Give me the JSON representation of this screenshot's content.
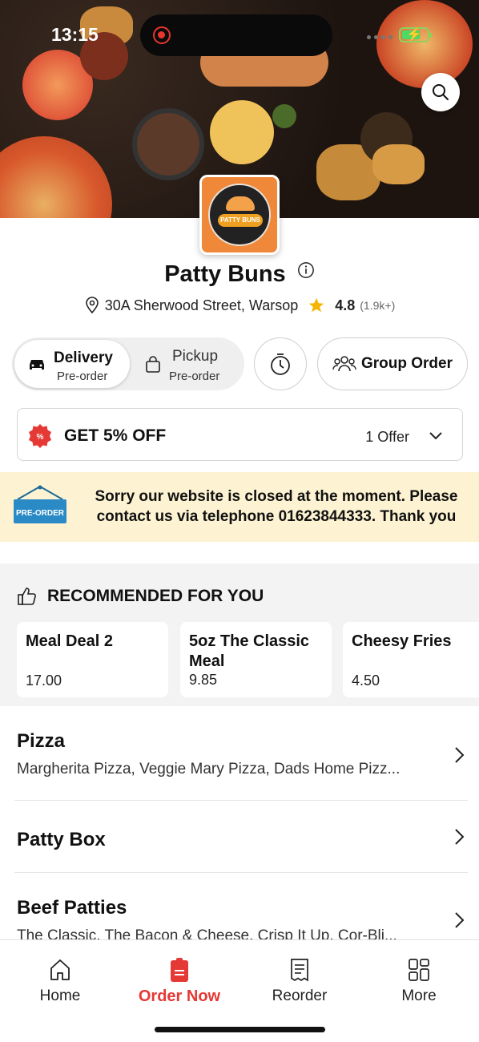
{
  "status": {
    "time": "13:15"
  },
  "restaurant": {
    "name": "Patty Buns",
    "logo_text": "PATTY BUNS",
    "address": "30A Sherwood Street, Warsop",
    "rating": "4.8",
    "rating_count": "(1.9k+)"
  },
  "order_mode": {
    "delivery_label": "Delivery",
    "delivery_sub": "Pre-order",
    "pickup_label": "Pickup",
    "pickup_sub": "Pre-order",
    "group_order_label": "Group Order"
  },
  "offer": {
    "title": "GET 5% OFF",
    "count": "1 Offer"
  },
  "notice": {
    "sign_text": "PRE-ORDER",
    "message": "Sorry our website is closed at the moment. Please contact us via telephone 01623844333. Thank you"
  },
  "recommended": {
    "heading": "RECOMMENDED FOR YOU",
    "items": [
      {
        "name": "Meal Deal 2",
        "price": "17.00"
      },
      {
        "name": "5oz The Classic Meal",
        "price": "9.85"
      },
      {
        "name": "Cheesy Fries",
        "price": "4.50"
      }
    ]
  },
  "categories": [
    {
      "title": "Pizza",
      "desc": "Margherita Pizza, Veggie Mary Pizza, Dads Home Pizz..."
    },
    {
      "title": "Patty Box",
      "desc": ""
    },
    {
      "title": "Beef Patties",
      "desc": "The Classic, The Bacon & Cheese, Crisp It Up, Cor-Bli..."
    }
  ],
  "tabs": [
    {
      "label": "Home",
      "icon": "home-icon"
    },
    {
      "label": "Order Now",
      "icon": "order-icon"
    },
    {
      "label": "Reorder",
      "icon": "receipt-icon"
    },
    {
      "label": "More",
      "icon": "grid-icon"
    }
  ],
  "colors": {
    "accent": "#e53935",
    "notice_bg": "#fdf3d2",
    "star": "#f5b400",
    "logo_orange": "#f0883a"
  }
}
